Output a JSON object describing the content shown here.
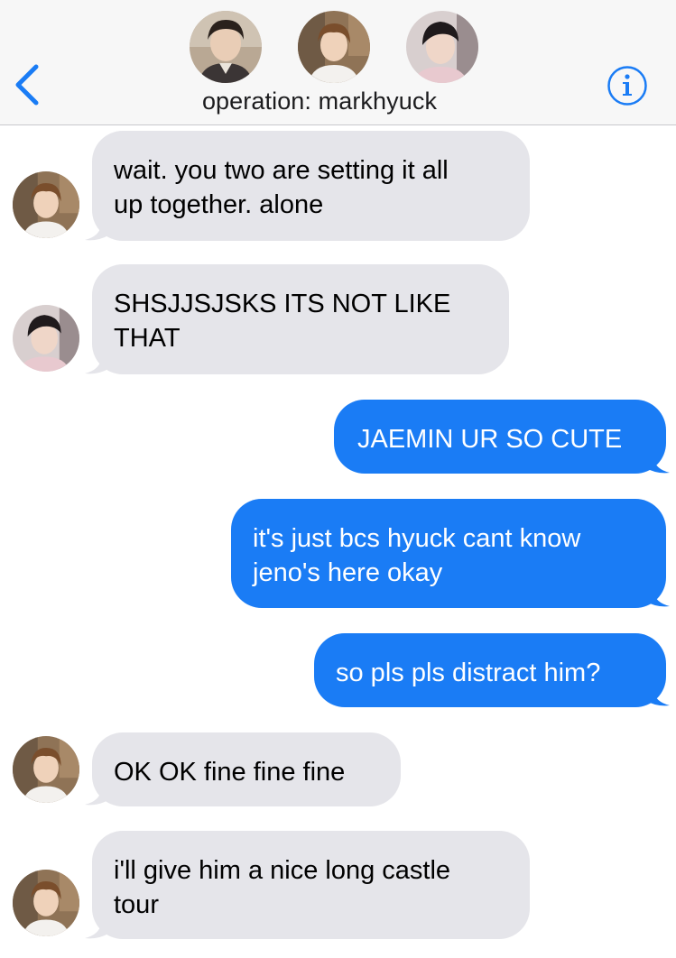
{
  "header": {
    "title": "operation: markhyuck",
    "back_icon": "chevron-left-icon",
    "info_icon": "info-icon",
    "accent_color": "#1a7cf5"
  },
  "messages": [
    {
      "direction": "incoming",
      "sender_avatar": "avatar-2",
      "text": "wait. you two are setting it all\nup together. alone"
    },
    {
      "direction": "incoming",
      "sender_avatar": "avatar-3",
      "text": "SHSJJSJSKS ITS NOT LIKE\nTHAT"
    },
    {
      "direction": "outgoing",
      "text": "JAEMIN UR SO CUTE"
    },
    {
      "direction": "outgoing",
      "text": "it's just bcs hyuck cant know\njeno's here okay"
    },
    {
      "direction": "outgoing",
      "text": "so pls pls distract him?"
    },
    {
      "direction": "incoming",
      "sender_avatar": "avatar-2",
      "text": "OK OK fine fine fine"
    },
    {
      "direction": "incoming",
      "sender_avatar": "avatar-2",
      "text": "i'll give him a nice long castle\ntour"
    }
  ],
  "colors": {
    "incoming_bubble": "#e5e5ea",
    "outgoing_bubble": "#1a7cf5",
    "header_bg": "#f7f7f7"
  }
}
